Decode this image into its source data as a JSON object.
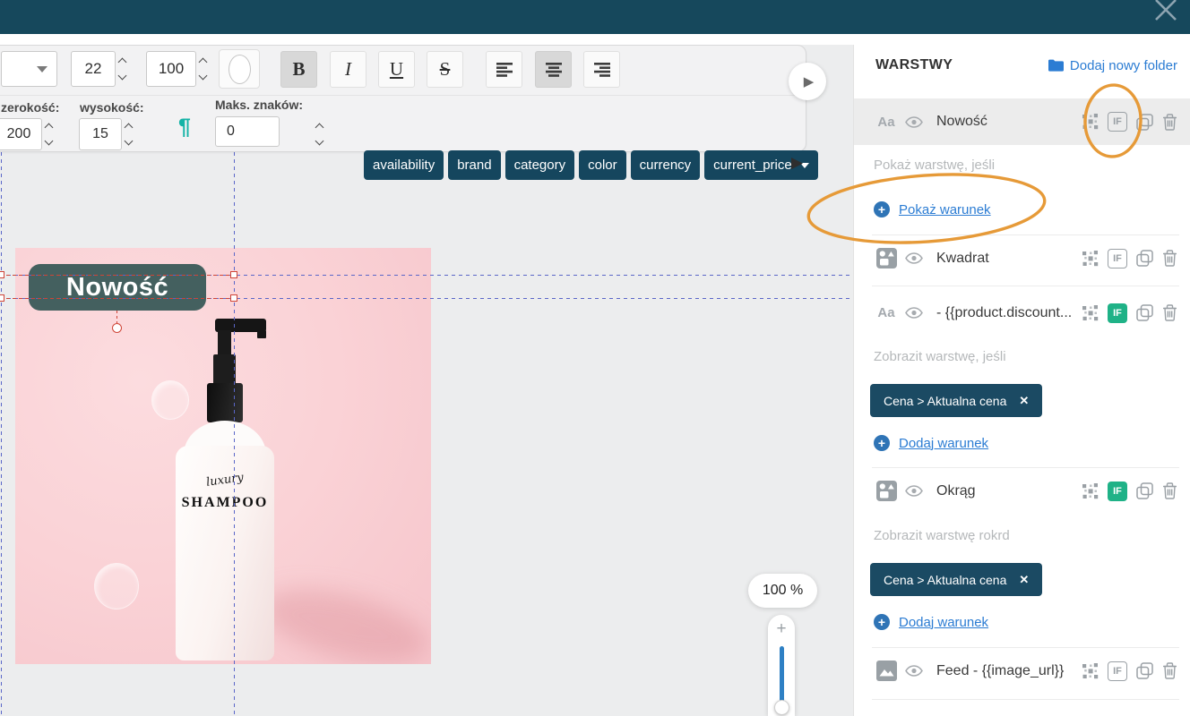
{
  "colors": {
    "topbar_teal": "#16485c",
    "chip_teal": "#15465e",
    "condition_chip_teal": "#1b4a63",
    "badge_green_slate": "#44605f",
    "if_green": "#1fb287",
    "link_blue": "#2b7cd3",
    "annotation_orange": "#e69a38",
    "selection_red": "#cf4436",
    "guide_blue": "#5a66c8",
    "slider_blue": "#2e80c4"
  },
  "topbar": {
    "close_icon": "close-x"
  },
  "toolbar": {
    "font_size": "22",
    "value_100": "100",
    "bold": "B",
    "italic": "I",
    "underline": "U",
    "strike": "S",
    "width_label": "zerokość:",
    "width_value": "200",
    "height_label": "wysokość:",
    "height_value": "15",
    "pilcrow": "¶",
    "max_chars_label": "Maks. znaków:",
    "max_chars_value": "0",
    "chips": [
      "availability",
      "brand",
      "category",
      "color",
      "currency"
    ],
    "chip_dropdown": "current_price",
    "more_arrow": "▶"
  },
  "canvas": {
    "badge": "Nowość",
    "bottle_script": "luxury",
    "bottle_brand": "SHAMPOO",
    "zoom_level": "100 %",
    "slider_plus": "+"
  },
  "layers": {
    "title": "WARSTWY",
    "add_folder": "Dodaj nowy folder",
    "aa_icon": "Aa",
    "if_label": "IF",
    "row1": "Nowość",
    "show_if": "Pokaż warstwę, jeśli",
    "show_condition": "Pokaż warunek",
    "row2": "Kwadrat",
    "row3": "- {{product.discount...",
    "display_if": "Zobrazit warstwę, jeśli",
    "condition_chip": "Cena > Aktualna cena",
    "chip_close": "✕",
    "add_condition": "Dodaj warunek",
    "row4": "Okrąg",
    "display_if2": "Zobrazit warstwę rokrd",
    "row5": "Feed - {{image_url}}",
    "plus": "+"
  }
}
